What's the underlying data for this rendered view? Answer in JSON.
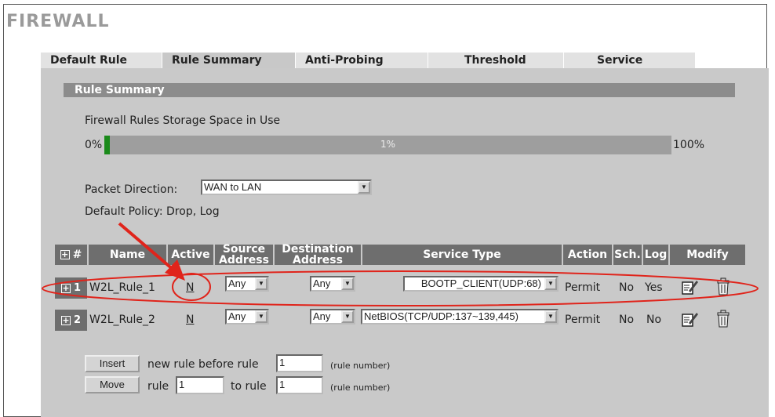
{
  "page": {
    "title": "FIREWALL"
  },
  "tabs": [
    {
      "label": "Default Rule"
    },
    {
      "label": "Rule Summary"
    },
    {
      "label": "Anti-Probing"
    },
    {
      "label": "Threshold"
    },
    {
      "label": "Service"
    }
  ],
  "section": {
    "title": "Rule Summary"
  },
  "storage": {
    "label": "Firewall Rules Storage Space in Use",
    "min_label": "0%",
    "max_label": "100%",
    "value_label": "1%",
    "percent": 1
  },
  "direction": {
    "label": "Packet Direction:",
    "value": "WAN to LAN"
  },
  "policy": {
    "text": "Default Policy: Drop, Log"
  },
  "table": {
    "headers": {
      "num": "#",
      "name": "Name",
      "active": "Active",
      "source": "Source Address",
      "dest": "Destination Address",
      "service": "Service Type",
      "action": "Action",
      "sch": "Sch.",
      "log": "Log",
      "modify": "Modify"
    },
    "rows": [
      {
        "num": "1",
        "name": "W2L_Rule_1",
        "active": "N",
        "source": "Any",
        "dest": "Any",
        "service": "BOOTP_CLIENT(UDP:68)",
        "action": "Permit",
        "sch": "No",
        "log": "Yes"
      },
      {
        "num": "2",
        "name": "W2L_Rule_2",
        "active": "N",
        "source": "Any",
        "dest": "Any",
        "service": "NetBIOS(TCP/UDP:137~139,445)",
        "action": "Permit",
        "sch": "No",
        "log": "No"
      }
    ]
  },
  "insert": {
    "button": "Insert",
    "text": "new rule before rule",
    "value": "1",
    "hint": "(rule number)"
  },
  "move": {
    "button": "Move",
    "text1": "rule",
    "value1": "1",
    "text2": "to rule",
    "value2": "1",
    "hint": "(rule number)"
  },
  "colors": {
    "header_bg": "#6e6e6e",
    "panel_bg": "#c9c9c9",
    "bar_fill": "#1a8a1a",
    "annotation": "#e0241b"
  }
}
